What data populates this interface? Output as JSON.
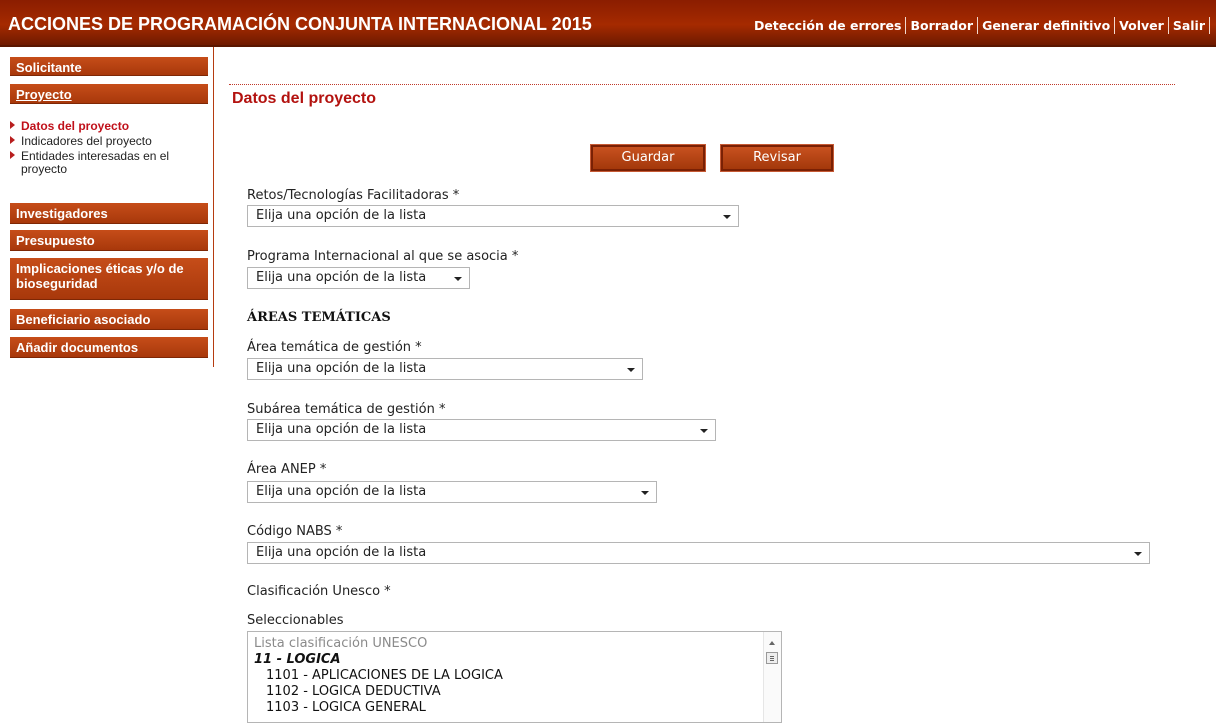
{
  "header": {
    "title": "ACCIONES DE PROGRAMACIÓN CONJUNTA INTERNACIONAL 2015",
    "nav": [
      "Detección de errores",
      "Borrador",
      "Generar definitivo",
      "Volver",
      "Salir"
    ]
  },
  "sidebar": {
    "sections": [
      "Solicitante",
      "Proyecto",
      "Investigadores",
      "Presupuesto",
      "Implicaciones éticas y/o de bioseguridad",
      "Beneficiario asociado",
      "Añadir documentos"
    ],
    "subitems": [
      "Datos del proyecto",
      "Indicadores del proyecto",
      "Entidades interesadas en el proyecto"
    ]
  },
  "main": {
    "title": "Datos del proyecto",
    "buttons": {
      "save": "Guardar",
      "review": "Revisar"
    },
    "fields": {
      "retos_label": "Retos/Tecnologías Facilitadoras  *",
      "programa_label": "Programa Internacional al que se asocia  *",
      "areas_title": "ÁREAS TEMÁTICAS",
      "area_gestion_label": "Área temática de gestión  *",
      "subarea_label": "Subárea temática de gestión  *",
      "anep_label": "Área ANEP  *",
      "nabs_label": "Código NABS *",
      "unesco_label": "Clasificación Unesco *",
      "seleccionables_label": "Seleccionables"
    },
    "select_placeholder": "Elija una opción de la lista",
    "unesco_list": {
      "header": "Lista clasificación UNESCO",
      "group": "11 - LOGICA",
      "items": [
        "1101 - APLICACIONES DE LA LOGICA",
        "1102 - LOGICA DEDUCTIVA",
        "1103 - LOGICA GENERAL"
      ]
    }
  },
  "colors": {
    "header_bg": "#a52a00",
    "sidebar_button": "#b8410f",
    "accent_red": "#b3120f"
  }
}
